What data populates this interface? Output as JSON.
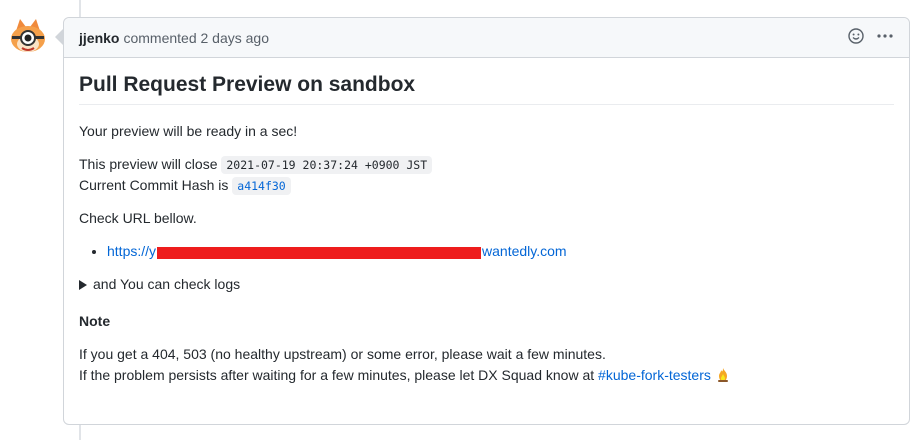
{
  "comment": {
    "author": "jjenko",
    "meta": "commented 2 days ago",
    "icons": [
      "smiley-icon",
      "kebab-menu-icon"
    ]
  },
  "body": {
    "title": "Pull Request Preview on sandbox",
    "ready_text": "Your preview will be ready in a sec!",
    "close_label": "This preview will close",
    "close_time": "2021-07-19 20:37:24 +0900 JST",
    "hash_label": "Current Commit Hash is",
    "hash_value": "a414f30",
    "check_url": "Check URL bellow.",
    "url_prefix": "https://y",
    "url_suffix": "wantedly.com",
    "logs_summary": "and You can check logs",
    "note_title": "Note",
    "note_line1": "If you get a 404, 503 (no healthy upstream) or some error, please wait a few minutes.",
    "note_line2_prefix": "If the problem persists after waiting for a few minutes, please let DX Squad know at",
    "note_channel": "#kube-fork-testers"
  },
  "colors": {
    "link": "#0366d6",
    "redaction": "#ee1c1c",
    "header_bg": "#f6f8fa"
  }
}
